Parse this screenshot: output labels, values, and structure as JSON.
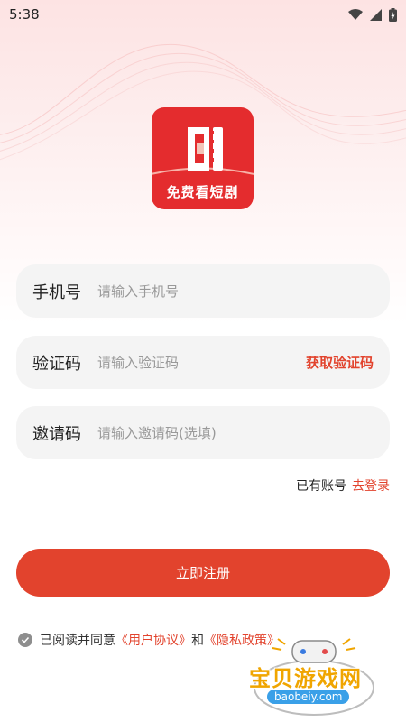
{
  "status_bar": {
    "time": "5:38"
  },
  "logo": {
    "caption": "免费看短剧"
  },
  "form": {
    "phone": {
      "label": "手机号",
      "placeholder": "请输入手机号"
    },
    "code": {
      "label": "验证码",
      "placeholder": "请输入验证码",
      "action": "获取验证码"
    },
    "invite": {
      "label": "邀请码",
      "placeholder": "请输入邀请码(选填)"
    }
  },
  "login": {
    "prompt": "已有账号",
    "link": "去登录"
  },
  "register_button": "立即注册",
  "agreement": {
    "prefix": "已阅读并同意",
    "user_agreement": "《用户协议》",
    "and": "和",
    "privacy_policy": "《隐私政策》"
  },
  "watermark": {
    "title": "宝贝游戏网",
    "url": "baobeiy.com"
  },
  "colors": {
    "accent": "#e2432d",
    "logo_bg": "#e42c2e",
    "field_bg": "#f4f4f4"
  }
}
